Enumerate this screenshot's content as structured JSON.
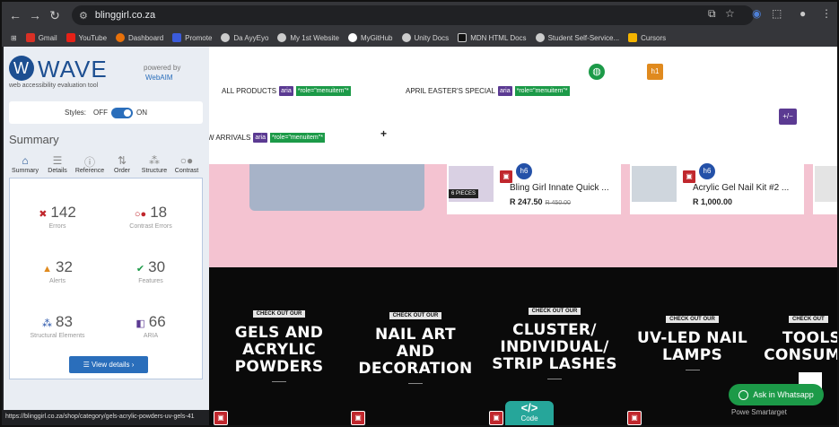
{
  "browser": {
    "url": "blinggirl.co.za",
    "bookmarks": [
      "Gmail",
      "YouTube",
      "Dashboard",
      "Promote",
      "Da AyyEyo",
      "My 1st Website",
      "MyGitHub",
      "Unity Docs",
      "MDN HTML Docs",
      "Student Self-Service...",
      "Cursors"
    ],
    "status_url": "https://blinggirl.co.za/shop/category/gels-acrylic-powders-uv-gels-41"
  },
  "wave": {
    "title": "WAVE",
    "subtitle": "web accessibility evaluation tool",
    "powered_by": "powered by",
    "powered_org": "WebAIM",
    "styles_label": "Styles:",
    "styles_off": "OFF",
    "styles_on": "ON",
    "section_title": "Summary",
    "tabs": [
      "Summary",
      "Details",
      "Reference",
      "Order",
      "Structure",
      "Contrast"
    ],
    "stats": {
      "errors": {
        "count": "142",
        "label": "Errors"
      },
      "contrast": {
        "count": "18",
        "label": "Contrast Errors"
      },
      "alerts": {
        "count": "32",
        "label": "Alerts"
      },
      "features": {
        "count": "30",
        "label": "Features"
      },
      "structural": {
        "count": "83",
        "label": "Structural Elements"
      },
      "aria": {
        "count": "66",
        "label": "ARIA"
      }
    },
    "view_details": "View details ›"
  },
  "site": {
    "menu": [
      {
        "label": "ALL PRODUCTS",
        "aria": "aria",
        "role": "*role=\"menuitem\"*"
      },
      {
        "label": "APRIL EASTER'S SPECIAL",
        "aria": "aria",
        "role": "*role=\"menuitem\"*"
      },
      {
        "label": "W ARRIVALS",
        "aria": "aria",
        "role": "*role=\"menuitem\"*"
      }
    ],
    "h1_tag": "h1",
    "plusminus": "+/−",
    "h6_tag": "h6",
    "pieces_badge": "6 PIECES",
    "products": [
      {
        "name": "Bling Girl Innate Quick ...",
        "price": "R 247.50",
        "old_price": "R 450.00"
      },
      {
        "name": "Acrylic Gel Nail Kit #2 ...",
        "price": "R 1,000.00",
        "old_price": ""
      }
    ],
    "categories": [
      {
        "badge": "CHECK OUT OUR",
        "title": "GELS AND ACRYLIC POWDERS"
      },
      {
        "badge": "CHECK OUT OUR",
        "title": "NAIL ART AND DECORATION"
      },
      {
        "badge": "CHECK OUT OUR",
        "title": "CLUSTER/ INDIVIDUAL/ STRIP LASHES"
      },
      {
        "badge": "CHECK OUT OUR",
        "title": "UV-LED NAIL LAMPS"
      },
      {
        "badge": "CHECK OUT",
        "title": "TOOLS CONSUM"
      }
    ],
    "whatsapp": "Ask in Whatsapp",
    "code_label": "Code",
    "powered_smartarget": "Powe   Smartarget"
  }
}
